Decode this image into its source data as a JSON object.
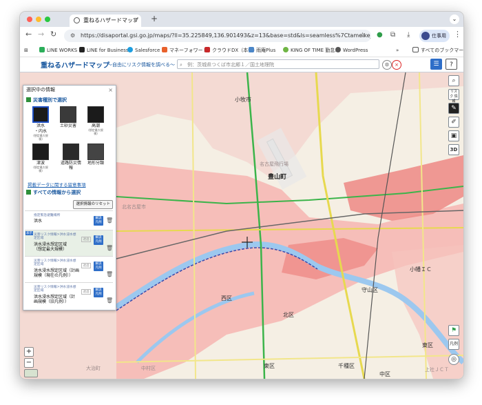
{
  "browser": {
    "tab_title": "重ねるハザードマップ",
    "url": "https://disaportal.gsi.go.jp/maps/?ll=35.225849,136.901493&z=13&base=std&ls=seamless%7Ctameike_raster%2C0.8%...",
    "profile_label": "仕事用",
    "bookmarks": [
      "LINE WORKS",
      "LINE for Business",
      "Salesforce",
      "マネーフォワード",
      "クラウドDX（本番）",
      "雨庵Plus",
      "KING OF TIME 勤怠...",
      "WordPress"
    ],
    "bookmarks_more": "»",
    "all_bookmarks": "すべてのブックマーク"
  },
  "site": {
    "title": "重ねるハザードマップ",
    "subtitle": "～自由にリスク情報を調べる～",
    "search_placeholder": "例：茨城県つくば市北郷１／国土地理院",
    "help": "?"
  },
  "panel": {
    "title": "選択中の情報",
    "close": "×",
    "section_hazard": "災害種別で選択",
    "hazards": [
      {
        "icon": "flood-icon",
        "label": "洪水",
        "sub": "・内水",
        "note": "(想定最大規模)"
      },
      {
        "icon": "landslide-icon",
        "label": "土砂災害",
        "sub": "",
        "note": ""
      },
      {
        "icon": "storm-surge-icon",
        "label": "高潮",
        "sub": "",
        "note": "(想定最大規模)"
      },
      {
        "icon": "tsunami-icon",
        "label": "津波",
        "sub": "",
        "note": "(想定最大規模)"
      },
      {
        "icon": "road-disaster-icon",
        "label": "道路防災情報",
        "sub": "",
        "note": ""
      },
      {
        "icon": "landform-icon",
        "label": "地形分類",
        "sub": "",
        "note": ""
      }
    ],
    "data_notes_link": "掲載データに関する留意事項",
    "section_all": "すべての情報から選択",
    "reset_button": "選択情報のリセット",
    "selected_items": [
      {
        "category": "指定緊急避難場所",
        "name": "洪水",
        "legend": "解説\n凡例",
        "toggle": ""
      },
      {
        "category": "災害リスク情報>洪水浸水想定区域",
        "name": "洪水浸水想定区域\n（想定最大規模）",
        "legend": "解説\n凡例",
        "toggle": "透過"
      },
      {
        "category": "災害リスク情報>洪水浸水想定区域",
        "name": "洪水浸水想定区域（計画\n規模（現在の凡例））",
        "legend": "解説\n凡例",
        "toggle": "透過"
      },
      {
        "category": "災害リスク情報>洪水浸水想定区域",
        "name": "洪水浸水想定区域（計\n画規模（旧凡例））",
        "legend": "解説\n凡例",
        "toggle": "透過"
      }
    ],
    "active_badge": "表示"
  },
  "map": {
    "labels": [
      "小牧市",
      "豊山町",
      "名古屋飛行場",
      "北名古屋市",
      "西区",
      "北区",
      "守山区",
      "東区",
      "東区",
      "千種区",
      "中村区",
      "大治町",
      "中区",
      "小幡ＩＣ",
      "上社ＪＣＴ"
    ],
    "tools": [
      "magnifier-icon",
      "risk-icon",
      "draw-icon",
      "pencil-icon",
      "toolbox-icon",
      "3d-icon"
    ],
    "tool_labels": [
      "",
      "リスク\n情報",
      "",
      "",
      "",
      "3D"
    ],
    "zoom_in": "+",
    "zoom_out": "−",
    "legend_button": "凡例",
    "overlay_color": "#f6b8b4",
    "overlay_dark": "#ee8e8a"
  }
}
